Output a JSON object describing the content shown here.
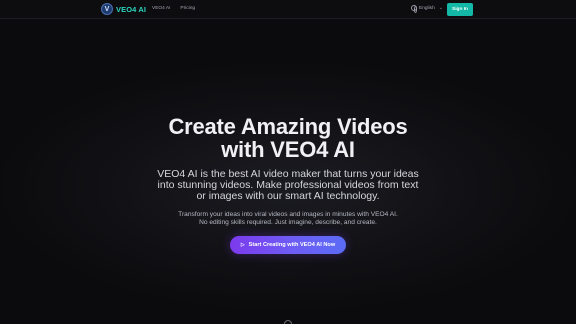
{
  "header": {
    "logo_letter": "V",
    "brand": "VEO4 AI",
    "nav": [
      "VEO4 AI",
      "Pricing"
    ],
    "language": "English",
    "signin_label": "Sign In"
  },
  "hero": {
    "title_line1": "Create Amazing Videos",
    "title_line2": "with VEO4 AI",
    "subtitle": "VEO4 AI is the best AI video maker that turns your ideas into stunning videos. Make professional videos from text or images with our smart AI technology.",
    "desc_line1": "Transform your ideas into viral videos and images in minutes with VEO4 AI.",
    "desc_line2": "No editing skills required. Just imagine, describe, and create.",
    "cta_label": "Start Creating with VEO4 AI Now"
  },
  "colors": {
    "brand_teal": "#2dd4bf",
    "signin_bg": "#14b8a6",
    "cta_gradient_start": "#7c3aed",
    "cta_gradient_end": "#5b6cf6",
    "background": "#0a0a0c"
  },
  "icons": [
    "logo-badge",
    "globe-icon",
    "chevron-down-icon",
    "play-icon",
    "scroll-down-icon"
  ]
}
